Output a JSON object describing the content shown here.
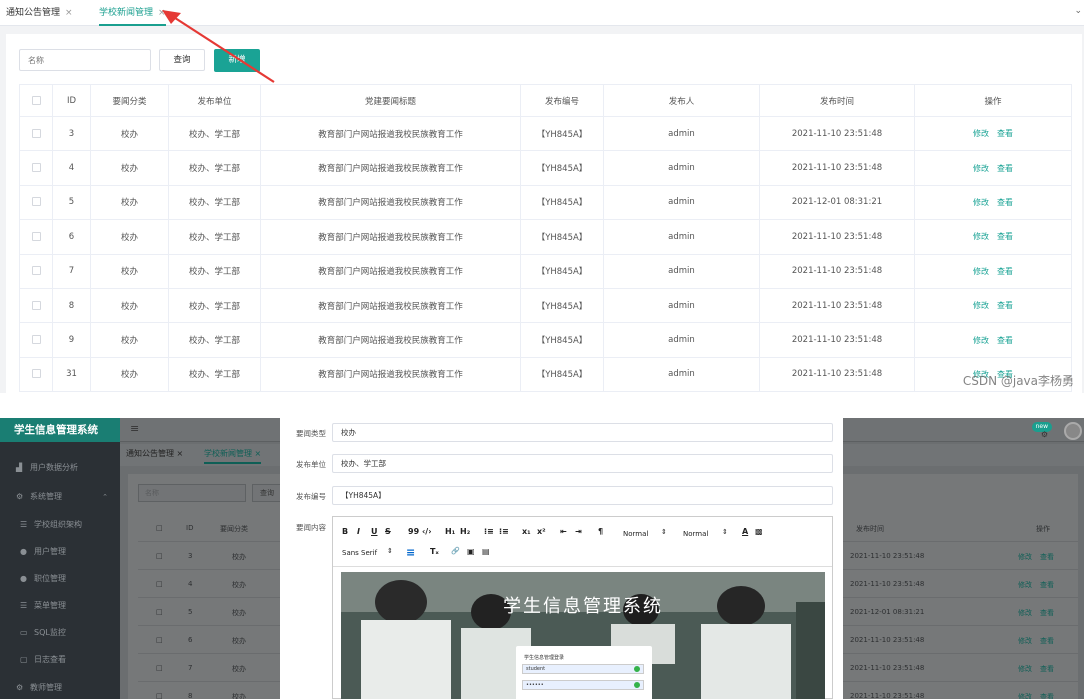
{
  "top": {
    "tabs": [
      {
        "label": "通知公告管理",
        "close": "×",
        "active": false
      },
      {
        "label": "学校新闻管理",
        "close": "×",
        "active": true
      }
    ],
    "tabs_dropdown": "⌄",
    "search": {
      "placeholder": "名称",
      "query_label": "查询",
      "add_label": "新增"
    },
    "table": {
      "headers": [
        "ID",
        "要闻分类",
        "发布单位",
        "党建要闻标题",
        "发布编号",
        "发布人",
        "发布时间",
        "操作"
      ],
      "rows": [
        {
          "id": "3",
          "cat": "校办",
          "unit": "校办、学工部",
          "title": "教育部门户网站报道我校民族教育工作",
          "no": "【YH845A】",
          "user": "admin",
          "time": "2021-11-10 23:51:48"
        },
        {
          "id": "4",
          "cat": "校办",
          "unit": "校办、学工部",
          "title": "教育部门户网站报道我校民族教育工作",
          "no": "【YH845A】",
          "user": "admin",
          "time": "2021-11-10 23:51:48"
        },
        {
          "id": "5",
          "cat": "校办",
          "unit": "校办、学工部",
          "title": "教育部门户网站报道我校民族教育工作",
          "no": "【YH845A】",
          "user": "admin",
          "time": "2021-12-01 08:31:21"
        },
        {
          "id": "6",
          "cat": "校办",
          "unit": "校办、学工部",
          "title": "教育部门户网站报道我校民族教育工作",
          "no": "【YH845A】",
          "user": "admin",
          "time": "2021-11-10 23:51:48"
        },
        {
          "id": "7",
          "cat": "校办",
          "unit": "校办、学工部",
          "title": "教育部门户网站报道我校民族教育工作",
          "no": "【YH845A】",
          "user": "admin",
          "time": "2021-11-10 23:51:48"
        },
        {
          "id": "8",
          "cat": "校办",
          "unit": "校办、学工部",
          "title": "教育部门户网站报道我校民族教育工作",
          "no": "【YH845A】",
          "user": "admin",
          "time": "2021-11-10 23:51:48"
        },
        {
          "id": "9",
          "cat": "校办",
          "unit": "校办、学工部",
          "title": "教育部门户网站报道我校民族教育工作",
          "no": "【YH845A】",
          "user": "admin",
          "time": "2021-11-10 23:51:48"
        },
        {
          "id": "31",
          "cat": "校办",
          "unit": "校办、学工部",
          "title": "教育部门户网站报道我校民族教育工作",
          "no": "【YH845A】",
          "user": "admin",
          "time": "2021-11-10 23:51:48"
        }
      ],
      "edit_label": "修改",
      "view_label": "查看"
    },
    "watermark": "CSDN @java李杨勇",
    "arrow_color": "#e53935"
  },
  "bottom": {
    "sidebar": {
      "title": "学生信息管理系统",
      "items": [
        {
          "label": "用户数据分析",
          "icon": "chart-icon"
        },
        {
          "label": "系统管理",
          "icon": "gear-icon"
        },
        {
          "label": "学校组织架构",
          "icon": "list-icon"
        },
        {
          "label": "用户管理",
          "icon": "user-icon"
        },
        {
          "label": "职位管理",
          "icon": "user-icon"
        },
        {
          "label": "菜单管理",
          "icon": "list-icon"
        },
        {
          "label": "SQL监控",
          "icon": "monitor-icon"
        },
        {
          "label": "日志查看",
          "icon": "log-icon"
        },
        {
          "label": "教师管理",
          "icon": "gear-icon"
        }
      ]
    },
    "bg": {
      "tabs": [
        {
          "label": "通知公告管理 ×"
        },
        {
          "label": "学校新闻管理 ×"
        }
      ],
      "search_placeholder": "名称",
      "query_label": "查询",
      "header_id": "ID",
      "header_cat": "要闻分类",
      "header_time": "发布时间",
      "header_op": "操作",
      "badge": "new",
      "rows": [
        {
          "id": "3",
          "cat": "校办",
          "time": "2021-11-10 23:51:48"
        },
        {
          "id": "4",
          "cat": "校办",
          "time": "2021-11-10 23:51:48"
        },
        {
          "id": "5",
          "cat": "校办",
          "time": "2021-12-01 08:31:21"
        },
        {
          "id": "6",
          "cat": "校办",
          "time": "2021-11-10 23:51:48"
        },
        {
          "id": "7",
          "cat": "校办",
          "time": "2021-11-10 23:51:48"
        },
        {
          "id": "8",
          "cat": "校办",
          "time": "2021-11-10 23:51:48"
        }
      ],
      "edit_label": "修改",
      "view_label": "查看"
    },
    "form": {
      "type_label": "要闻类型",
      "type_value": "校办",
      "unit_label": "发布单位",
      "unit_value": "校办、学工部",
      "no_label": "发布编号",
      "no_value": "【YH845A】",
      "content_label": "要闻内容",
      "toolbar": {
        "bold": "B",
        "italic": "I",
        "underline": "U",
        "strike": "S",
        "quote": "99",
        "code": "‹/›",
        "h1": "H₁",
        "h2": "H₂",
        "ol": "⁝≡",
        "ul": "⁝≡",
        "sub": "x₁",
        "sup": "x²",
        "outdent": "⇤",
        "indent": "⇥",
        "rtl": "¶",
        "size": "Normal",
        "header": "Normal",
        "size_caret": "⇕",
        "header_caret": "⇕",
        "color": "A",
        "bg": "▩",
        "font": "Sans Serif",
        "font_caret": "⇕",
        "align": "≡",
        "clean": "Tₓ",
        "link": "🔗",
        "image": "▣",
        "video": "▤"
      },
      "image_title": "学生信息管理系统",
      "login_title": "学生信息管理登录",
      "login_user": "student",
      "login_pwd": "••••••"
    }
  }
}
